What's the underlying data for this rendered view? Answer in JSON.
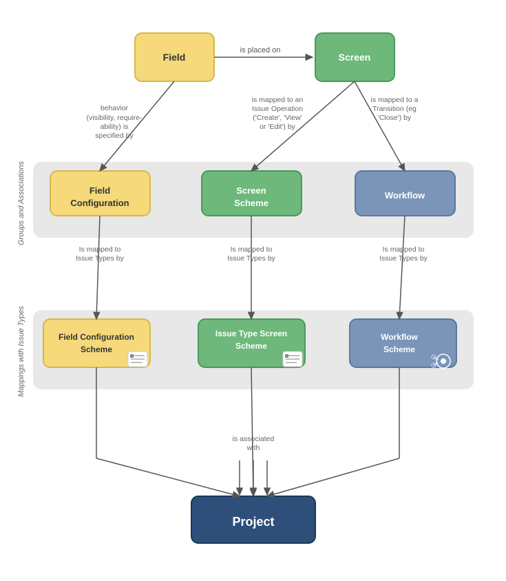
{
  "nodes": {
    "field": {
      "label": "Field"
    },
    "screen": {
      "label": "Screen"
    },
    "field_config": {
      "label": "Field Configuration"
    },
    "screen_scheme": {
      "label": "Screen Scheme"
    },
    "workflow": {
      "label": "Workflow"
    },
    "field_config_scheme": {
      "label": "Field Configuration Scheme"
    },
    "issue_type_screen_scheme": {
      "label": "Issue Type Screen Scheme"
    },
    "workflow_scheme": {
      "label": "Workflow Scheme"
    },
    "project": {
      "label": "Project"
    }
  },
  "annotations": {
    "is_placed_on": "is placed on",
    "behavior": "behavior\n(visibility, require-\nability) is\nspecified by",
    "mapped_to_operation": "is mapped to an\nIssue Operation\n('Create', 'View'\nor 'Edit') by",
    "mapped_to_transition": "is mapped to a\nTransition (eg\n'Close') by",
    "mapped_issue_types_1": "Is mapped to\nIssue Types by",
    "mapped_issue_types_2": "Is mapped to\nIssue Types by",
    "mapped_issue_types_3": "Is mapped to\nIssue Types by",
    "is_associated_with": "is associated\nwith"
  },
  "band_labels": {
    "groups": "Groups and Associations",
    "mappings": "Mappings with Issue Types"
  },
  "colors": {
    "yellow_bg": "#f5d97a",
    "yellow_border": "#d4b94a",
    "green_bg": "#6db87a",
    "green_border": "#4a9a5a",
    "blue_bg": "#7a95b8",
    "blue_border": "#5a78a0",
    "dark_blue_bg": "#2d4f7a",
    "dark_blue_border": "#1a3a5a",
    "band_bg": "#e8e8e8",
    "arrow": "#555555",
    "text": "#555555"
  }
}
